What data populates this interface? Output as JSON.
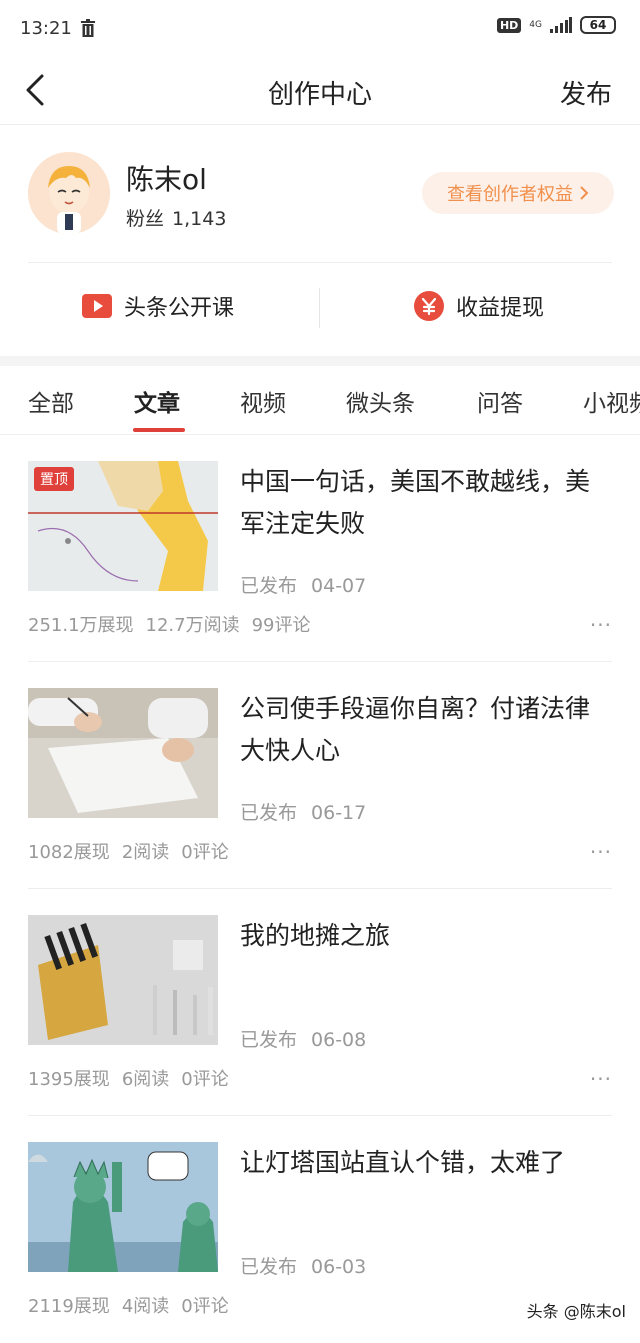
{
  "status_bar": {
    "time": "13:21",
    "hd": "HD",
    "network": "4G",
    "battery": "64"
  },
  "nav": {
    "title": "创作中心",
    "publish_label": "发布"
  },
  "profile": {
    "name": "陈末ol",
    "fans_label": "粉丝",
    "fans_count": "1,143",
    "rights_button": "查看创作者权益"
  },
  "quick_links": [
    {
      "label": "头条公开课",
      "icon": "play-icon",
      "color": "#e74c3c"
    },
    {
      "label": "收益提现",
      "icon": "yen-icon",
      "color": "#e74c3c"
    }
  ],
  "tabs": [
    "全部",
    "文章",
    "视频",
    "微头条",
    "问答",
    "小视频"
  ],
  "active_tab": "文章",
  "articles": [
    {
      "pinned": true,
      "pin_label": "置顶",
      "title": "中国一句话，美国不敢越线，美军注定失败",
      "status": "已发布",
      "date": "04-07",
      "impressions": "251.1万展现",
      "reads": "12.7万阅读",
      "comments": "99评论"
    },
    {
      "pinned": false,
      "title": "公司使手段逼你自离？付诸法律大快人心",
      "status": "已发布",
      "date": "06-17",
      "impressions": "1082展现",
      "reads": "2阅读",
      "comments": "0评论"
    },
    {
      "pinned": false,
      "title": "我的地摊之旅",
      "status": "已发布",
      "date": "06-08",
      "impressions": "1395展现",
      "reads": "6阅读",
      "comments": "0评论"
    },
    {
      "pinned": false,
      "title": "让灯塔国站直认个错，太难了",
      "status": "已发布",
      "date": "06-03",
      "impressions": "2119展现",
      "reads": "4阅读",
      "comments": "0评论"
    }
  ],
  "more_glyph": "···",
  "watermark": "头条 @陈末ol",
  "colors": {
    "accent": "#e0403a",
    "rights_text": "#f0904c",
    "rights_bg": "#fdf0e8"
  }
}
